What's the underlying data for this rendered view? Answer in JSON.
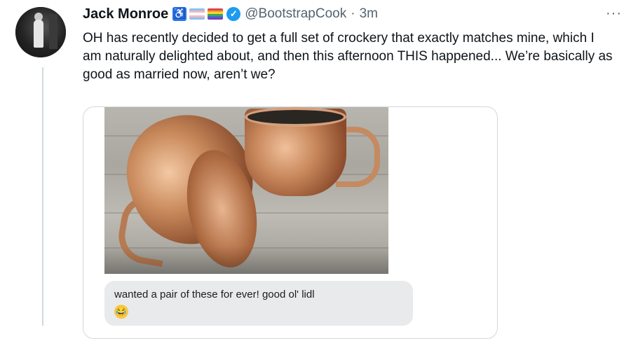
{
  "tweet": {
    "author_name": "Jack Monroe",
    "handle": "@BootstrapCook",
    "separator": "·",
    "time": "3m",
    "more_label": "···",
    "text": "OH has recently decided to get a full set of crockery that exactly matches mine, which I am naturally delighted about, and then this afternoon THIS happened... We’re basically as good as married now, aren’t we?"
  },
  "badges": {
    "accessibility_glyph": "♿",
    "verified_glyph": "✓",
    "flag_colors": [
      "#7fc6f1",
      "#f5b4c4",
      "#ffffff",
      "#e04545",
      "#f29a2e",
      "#f2d43a",
      "#3aa55a",
      "#3b6fd6",
      "#7b3fb5"
    ],
    "verified_color": "#1d9bf0"
  },
  "media": {
    "message_text": "wanted a pair of these for ever! good ol' lidl",
    "emoji": "😂"
  }
}
